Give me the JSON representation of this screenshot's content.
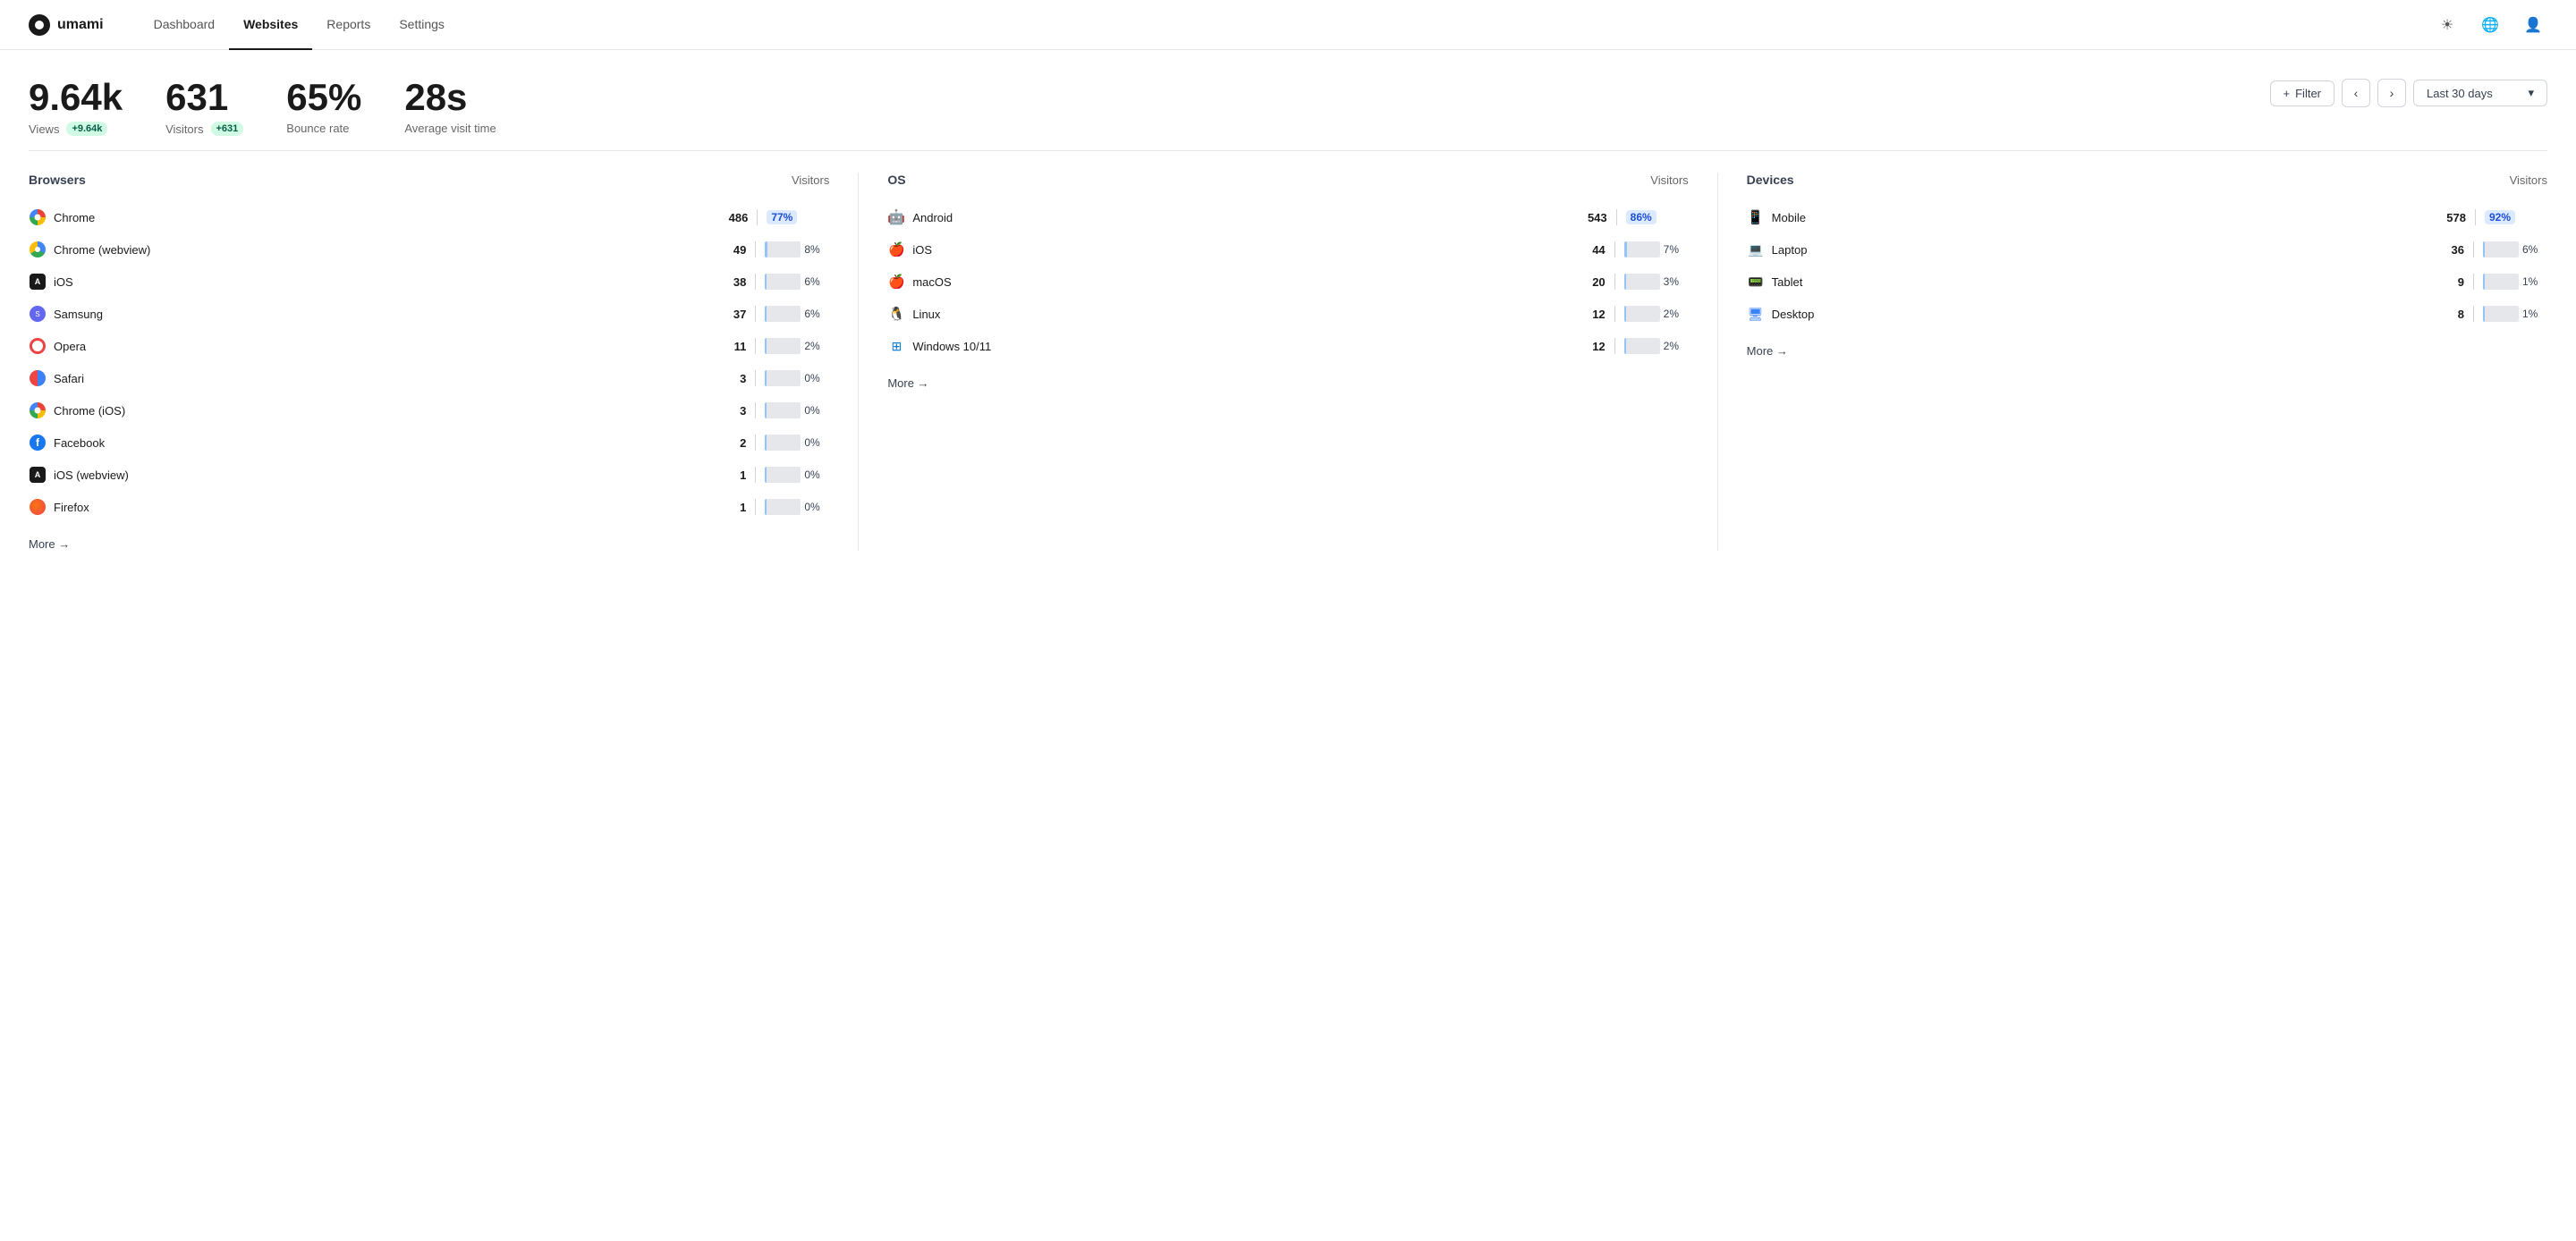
{
  "nav": {
    "logo_text": "umami",
    "links": [
      {
        "label": "Dashboard",
        "active": false
      },
      {
        "label": "Websites",
        "active": true
      },
      {
        "label": "Reports",
        "active": false
      },
      {
        "label": "Settings",
        "active": false
      }
    ]
  },
  "stats": {
    "views_value": "9.64k",
    "views_label": "Views",
    "views_badge": "+9.64k",
    "visitors_value": "631",
    "visitors_label": "Visitors",
    "visitors_badge": "+631",
    "bounce_value": "65%",
    "bounce_label": "Bounce rate",
    "avg_visit_value": "28s",
    "avg_visit_label": "Average visit time",
    "filter_label": "Filter",
    "date_label": "Last 30 days"
  },
  "browsers": {
    "title": "Browsers",
    "col_label": "Visitors",
    "rows": [
      {
        "name": "Chrome",
        "value": "486",
        "pct": "77%",
        "pct_num": 77,
        "highlighted": true,
        "icon": "chrome"
      },
      {
        "name": "Chrome (webview)",
        "value": "49",
        "pct": "8%",
        "pct_num": 8,
        "highlighted": false,
        "icon": "chrome-webview"
      },
      {
        "name": "iOS",
        "value": "38",
        "pct": "6%",
        "pct_num": 6,
        "highlighted": false,
        "icon": "ios"
      },
      {
        "name": "Samsung",
        "value": "37",
        "pct": "6%",
        "pct_num": 6,
        "highlighted": false,
        "icon": "samsung"
      },
      {
        "name": "Opera",
        "value": "11",
        "pct": "2%",
        "pct_num": 2,
        "highlighted": false,
        "icon": "opera"
      },
      {
        "name": "Safari",
        "value": "3",
        "pct": "0%",
        "pct_num": 0,
        "highlighted": false,
        "icon": "safari"
      },
      {
        "name": "Chrome (iOS)",
        "value": "3",
        "pct": "0%",
        "pct_num": 0,
        "highlighted": false,
        "icon": "chrome"
      },
      {
        "name": "Facebook",
        "value": "2",
        "pct": "0%",
        "pct_num": 0,
        "highlighted": false,
        "icon": "facebook"
      },
      {
        "name": "iOS (webview)",
        "value": "1",
        "pct": "0%",
        "pct_num": 0,
        "highlighted": false,
        "icon": "ios"
      },
      {
        "name": "Firefox",
        "value": "1",
        "pct": "0%",
        "pct_num": 0,
        "highlighted": false,
        "icon": "firefox"
      }
    ],
    "more_label": "More →"
  },
  "os": {
    "title": "OS",
    "col_label": "Visitors",
    "rows": [
      {
        "name": "Android",
        "value": "543",
        "pct": "86%",
        "pct_num": 86,
        "highlighted": true,
        "icon": "android"
      },
      {
        "name": "iOS",
        "value": "44",
        "pct": "7%",
        "pct_num": 7,
        "highlighted": false,
        "icon": "apple"
      },
      {
        "name": "macOS",
        "value": "20",
        "pct": "3%",
        "pct_num": 3,
        "highlighted": false,
        "icon": "apple"
      },
      {
        "name": "Linux",
        "value": "12",
        "pct": "2%",
        "pct_num": 2,
        "highlighted": false,
        "icon": "linux"
      },
      {
        "name": "Windows 10/11",
        "value": "12",
        "pct": "2%",
        "pct_num": 2,
        "highlighted": false,
        "icon": "windows"
      }
    ],
    "more_label": "More →"
  },
  "devices": {
    "title": "Devices",
    "col_label": "Visitors",
    "rows": [
      {
        "name": "Mobile",
        "value": "578",
        "pct": "92%",
        "pct_num": 92,
        "highlighted": true,
        "icon": "mobile"
      },
      {
        "name": "Laptop",
        "value": "36",
        "pct": "6%",
        "pct_num": 6,
        "highlighted": false,
        "icon": "laptop"
      },
      {
        "name": "Tablet",
        "value": "9",
        "pct": "1%",
        "pct_num": 1,
        "highlighted": false,
        "icon": "tablet"
      },
      {
        "name": "Desktop",
        "value": "8",
        "pct": "1%",
        "pct_num": 1,
        "highlighted": false,
        "icon": "desktop"
      }
    ],
    "more_label": "More →"
  }
}
